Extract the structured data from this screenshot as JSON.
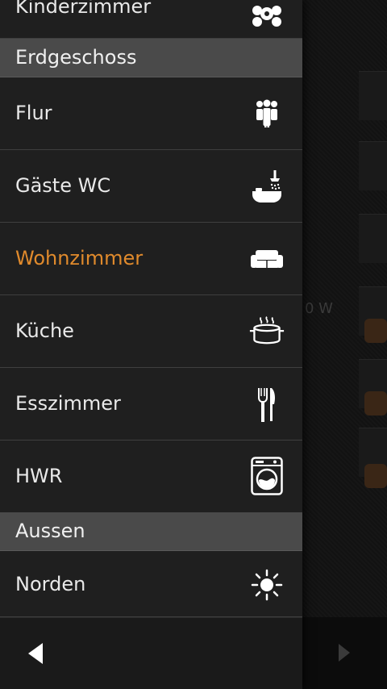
{
  "drawer": {
    "partial_top_item": {
      "label": "Kinderzimmer",
      "icon": "toys-icon"
    },
    "sections": [
      {
        "title": "Erdgeschoss",
        "items": [
          {
            "label": "Flur",
            "icon": "people-icon"
          },
          {
            "label": "Gäste WC",
            "icon": "shower-bath-icon"
          },
          {
            "label": "Wohnzimmer",
            "icon": "sofa-icon",
            "active": true
          },
          {
            "label": "Küche",
            "icon": "cooking-pot-icon"
          },
          {
            "label": "Esszimmer",
            "icon": "fork-knife-icon"
          },
          {
            "label": "HWR",
            "icon": "washing-machine-icon"
          }
        ]
      },
      {
        "title": "Aussen",
        "items": [
          {
            "label": "Norden",
            "icon": "sun-icon"
          }
        ]
      }
    ]
  },
  "background": {
    "partial_text": "0 W"
  },
  "colors": {
    "active": "#e08a2c",
    "drawer_bg": "#1f1f1f",
    "section_bg": "#4a4a4a"
  }
}
